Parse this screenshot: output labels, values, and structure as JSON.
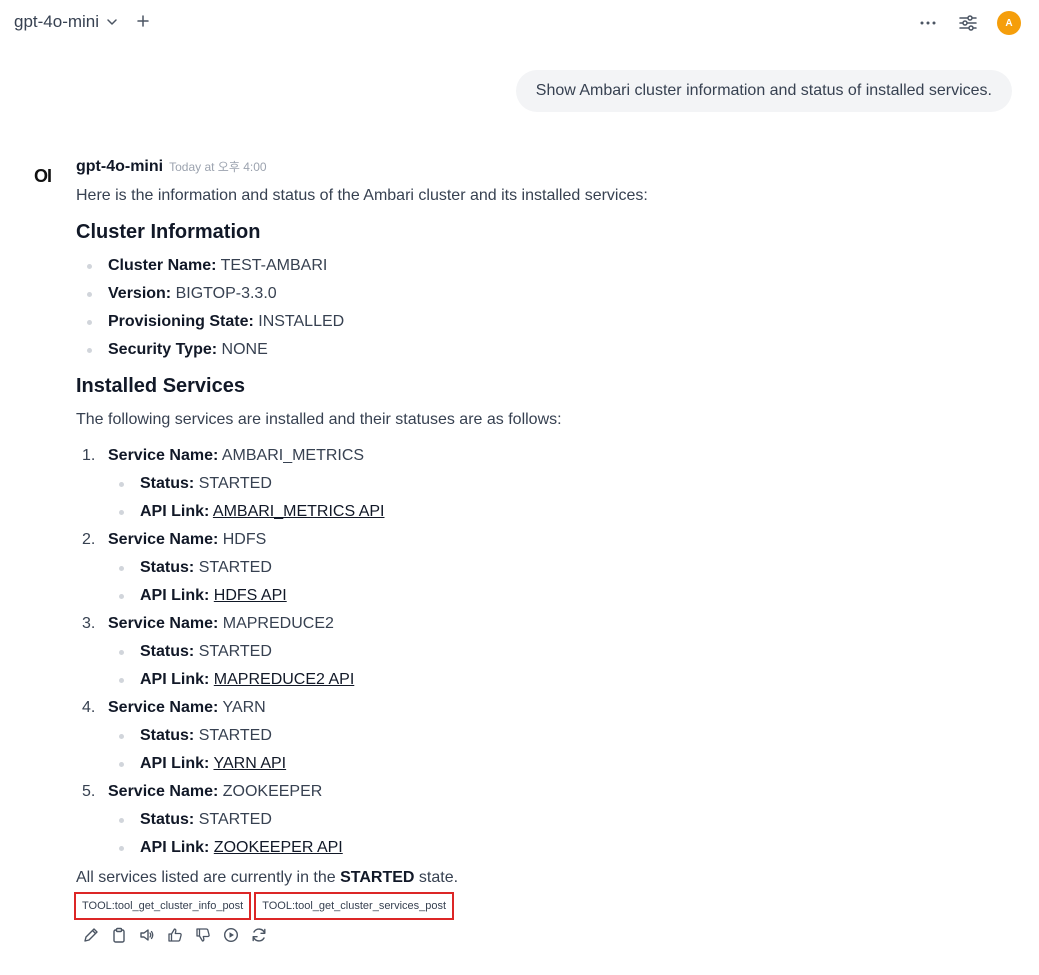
{
  "header": {
    "model_name": "gpt-4o-mini",
    "avatar_initial": "A"
  },
  "user_message": "Show Ambari cluster information and status of installed services.",
  "assistant": {
    "logo": "OI",
    "name": "gpt-4o-mini",
    "timestamp": "Today at 오후 4:00",
    "intro": "Here is the information and status of the Ambari cluster and its installed services:",
    "cluster_heading": "Cluster Information",
    "cluster_items": [
      {
        "label": "Cluster Name:",
        "value": "TEST-AMBARI"
      },
      {
        "label": "Version:",
        "value": "BIGTOP-3.3.0"
      },
      {
        "label": "Provisioning State:",
        "value": "INSTALLED"
      },
      {
        "label": "Security Type:",
        "value": "NONE"
      }
    ],
    "services_heading": "Installed Services",
    "services_intro": "The following services are installed and their statuses are as follows:",
    "service_name_label": "Service Name:",
    "status_label": "Status:",
    "api_label": "API Link:",
    "services": [
      {
        "num": "1.",
        "name": "AMBARI_METRICS",
        "status": "STARTED",
        "link": "AMBARI_METRICS API"
      },
      {
        "num": "2.",
        "name": "HDFS",
        "status": "STARTED",
        "link": "HDFS API"
      },
      {
        "num": "3.",
        "name": "MAPREDUCE2",
        "status": "STARTED",
        "link": "MAPREDUCE2 API"
      },
      {
        "num": "4.",
        "name": "YARN",
        "status": "STARTED",
        "link": "YARN API"
      },
      {
        "num": "5.",
        "name": "ZOOKEEPER",
        "status": "STARTED",
        "link": "ZOOKEEPER API"
      }
    ],
    "final_prefix": "All services listed are currently in the ",
    "final_bold": "STARTED",
    "final_suffix": " state.",
    "tools": [
      "TOOL:tool_get_cluster_info_post",
      "TOOL:tool_get_cluster_services_post"
    ]
  },
  "colors": {
    "avatar": "#f59e0b",
    "tool_border": "#dc2626",
    "bubble": "#f3f4f6"
  }
}
